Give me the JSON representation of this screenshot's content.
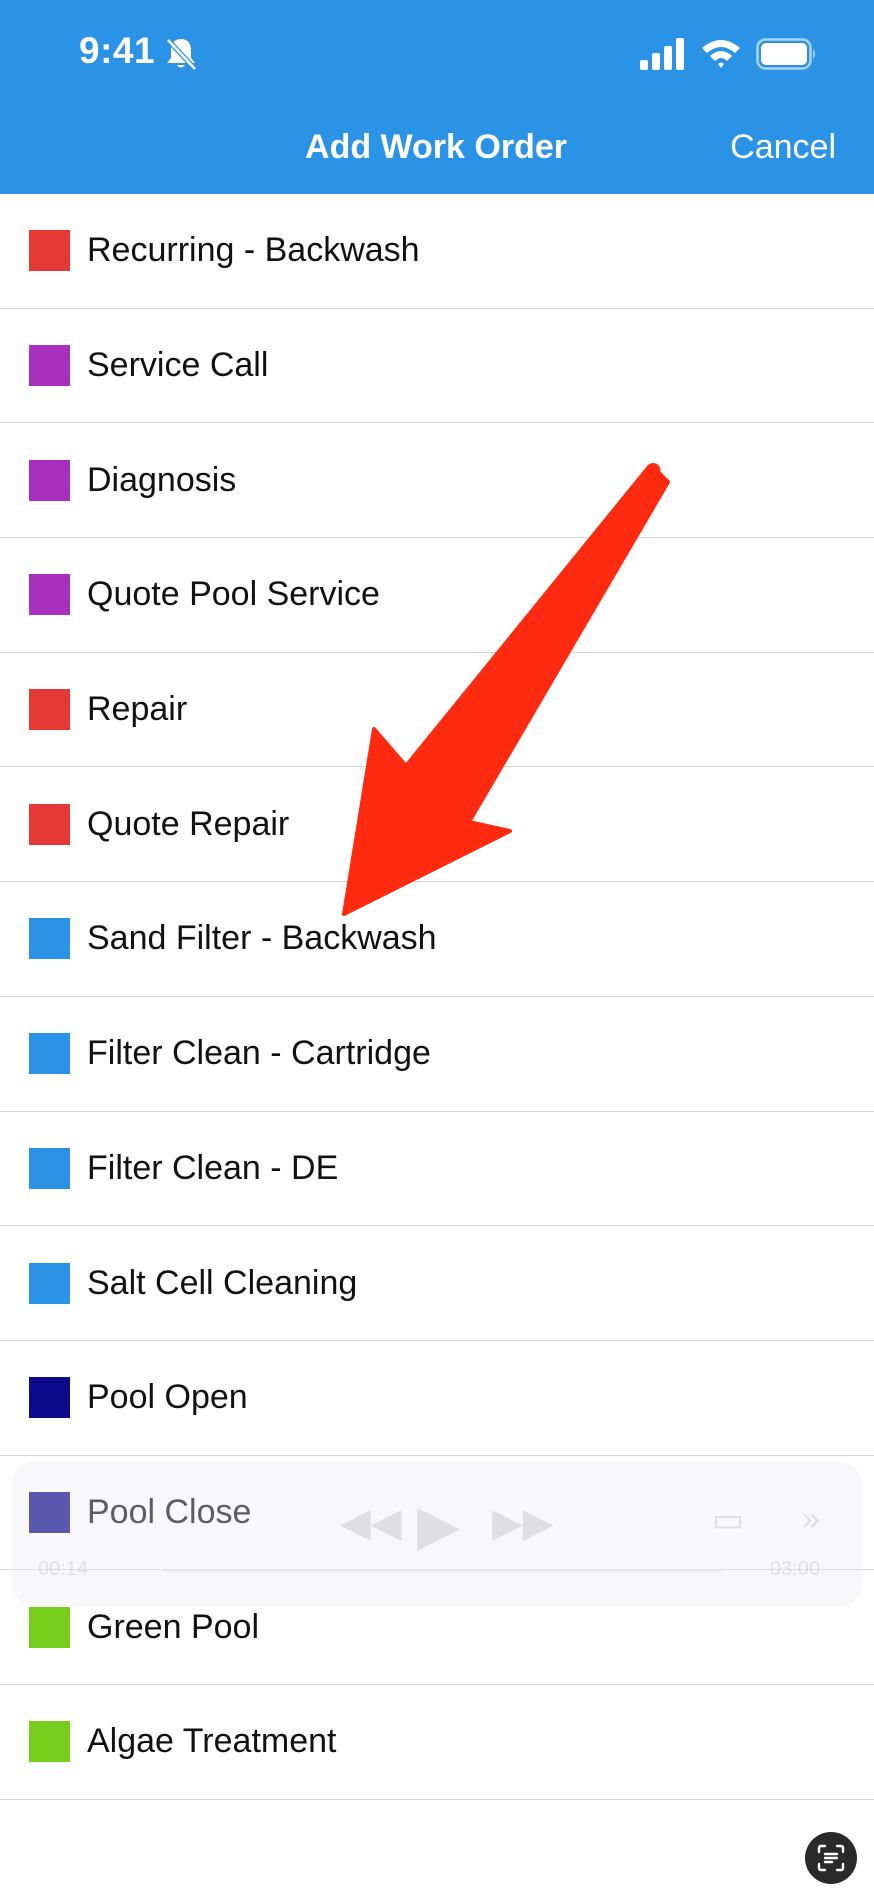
{
  "status_bar": {
    "time": "9:41",
    "icons": [
      "bell-slash-icon",
      "cellular-signal-icon",
      "wifi-icon",
      "battery-icon"
    ]
  },
  "nav": {
    "title": "Add Work Order",
    "cancel_label": "Cancel",
    "background_color": "#2b93e6"
  },
  "work_orders": [
    {
      "label": "Recurring - Backwash",
      "color": "#e53935"
    },
    {
      "label": "Service Call",
      "color": "#a62fbd"
    },
    {
      "label": "Diagnosis",
      "color": "#a62fbd"
    },
    {
      "label": "Quote Pool Service",
      "color": "#a62fbd"
    },
    {
      "label": "Repair",
      "color": "#e53935"
    },
    {
      "label": "Quote Repair",
      "color": "#e53935"
    },
    {
      "label": "Sand Filter - Backwash",
      "color": "#2b93e6"
    },
    {
      "label": "Filter Clean - Cartridge",
      "color": "#2b93e6"
    },
    {
      "label": "Filter Clean - DE",
      "color": "#2b93e6"
    },
    {
      "label": "Salt Cell Cleaning",
      "color": "#2b93e6"
    },
    {
      "label": "Pool Open",
      "color": "#0a0a8a"
    },
    {
      "label": "Pool Close",
      "color": "#0a0a8a"
    },
    {
      "label": "Green Pool",
      "color": "#77cc1c"
    },
    {
      "label": "Algae Treatment",
      "color": "#77cc1c"
    }
  ],
  "annotation": {
    "type": "arrow",
    "color": "#ff2a10",
    "points_to": "Sand Filter - Backwash"
  },
  "media_player": {
    "elapsed": "00:14",
    "duration": "03:00"
  },
  "floating_button": {
    "icon": "live-text-icon"
  }
}
